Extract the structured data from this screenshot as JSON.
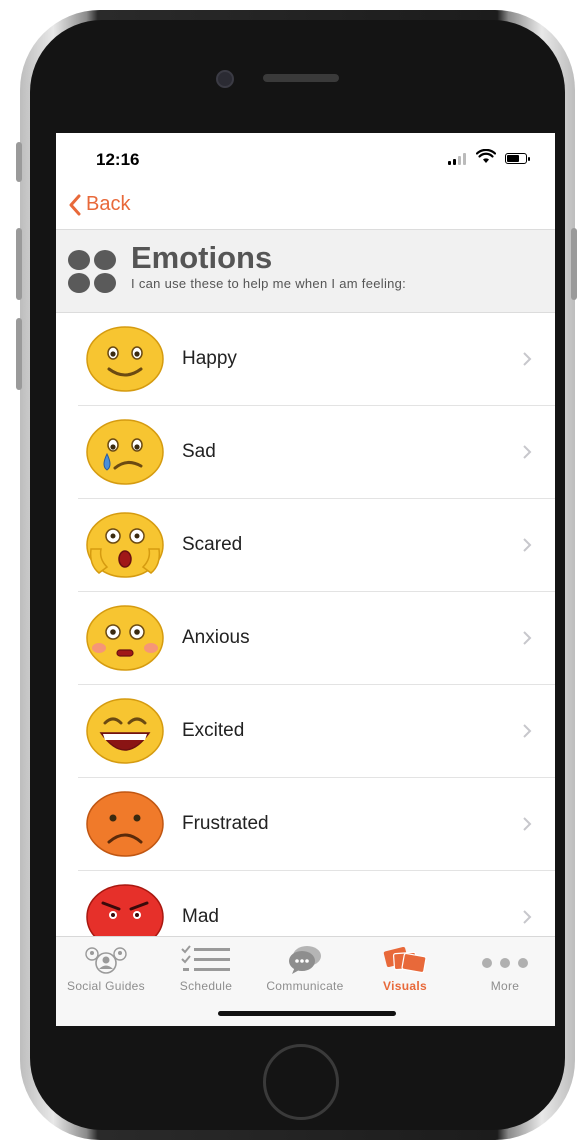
{
  "status": {
    "time": "12:16"
  },
  "nav": {
    "back_label": "Back"
  },
  "header": {
    "title": "Emotions",
    "subtitle": "I can use these to help me when I am feeling:"
  },
  "emotions": [
    {
      "label": "Happy",
      "icon": "happy-face-icon"
    },
    {
      "label": "Sad",
      "icon": "sad-face-icon"
    },
    {
      "label": "Scared",
      "icon": "scared-face-icon"
    },
    {
      "label": "Anxious",
      "icon": "anxious-face-icon"
    },
    {
      "label": "Excited",
      "icon": "excited-face-icon"
    },
    {
      "label": "Frustrated",
      "icon": "frustrated-face-icon"
    },
    {
      "label": "Mad",
      "icon": "mad-face-icon"
    }
  ],
  "tabs": [
    {
      "label": "Social Guides",
      "icon": "social-guides-icon",
      "active": false
    },
    {
      "label": "Schedule",
      "icon": "schedule-icon",
      "active": false
    },
    {
      "label": "Communicate",
      "icon": "communicate-icon",
      "active": false
    },
    {
      "label": "Visuals",
      "icon": "visuals-icon",
      "active": true
    },
    {
      "label": "More",
      "icon": "more-icon",
      "active": false
    }
  ],
  "colors": {
    "accent": "#e8693a",
    "emoji_yellow": "#f7c531",
    "emoji_orange": "#f07a2a",
    "emoji_red": "#e6302a"
  }
}
